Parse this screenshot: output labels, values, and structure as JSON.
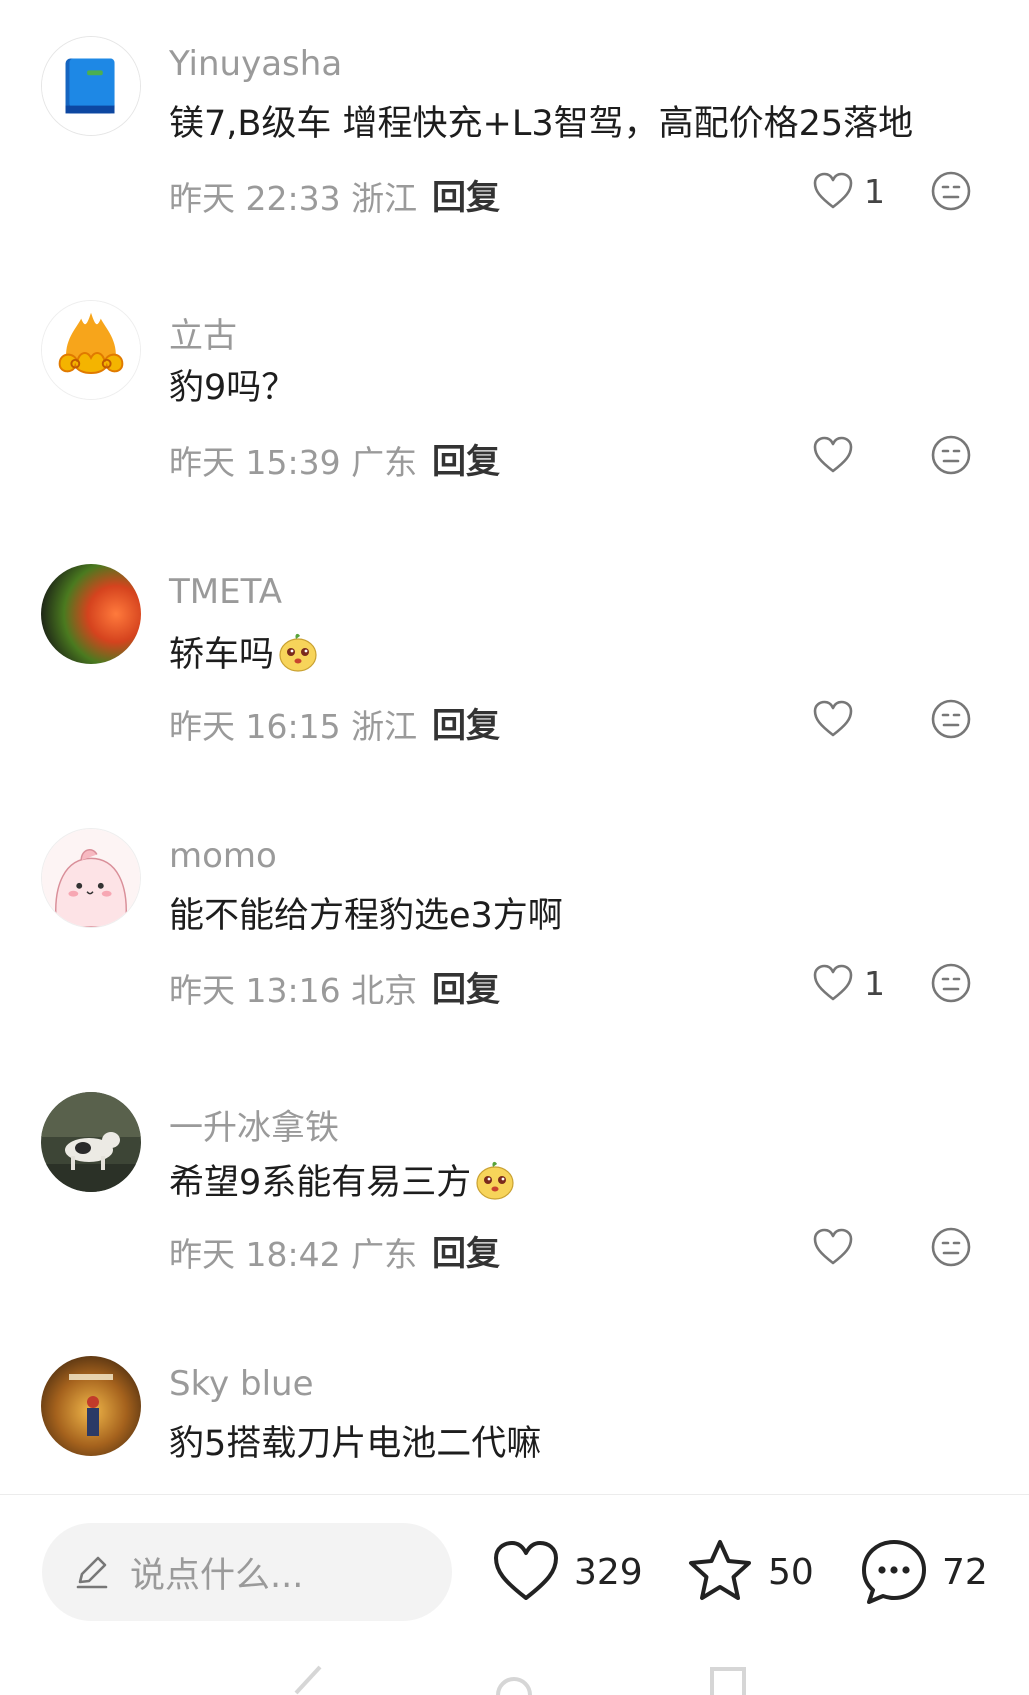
{
  "comments": [
    {
      "username": "Yinuyasha",
      "text": "镁7,B级车 增程快充+L3智驾，高配价格25落地",
      "time": "昨天 22:33 浙江",
      "reply": "回复",
      "likes": "1",
      "avatar": "blue-book-avatar"
    },
    {
      "username": "立古",
      "text": "豹9吗？",
      "time": "昨天 15:39 广东",
      "reply": "回复",
      "likes": "",
      "avatar": "golden-cloud-avatar"
    },
    {
      "username": "TMETA",
      "text": "轿车吗",
      "time": "昨天 16:15 浙江",
      "reply": "回复",
      "likes": "",
      "avatar": "gradient-avatar",
      "emoji": "cute-face-emoji"
    },
    {
      "username": "momo",
      "text": "能不能给方程豹选e3方啊",
      "time": "昨天 13:16 北京",
      "reply": "回复",
      "likes": "1",
      "avatar": "pink-cartoon-avatar"
    },
    {
      "username": "一升冰拿铁",
      "text": "希望9系能有易三方",
      "time": "昨天 18:42 广东",
      "reply": "回复",
      "likes": "",
      "avatar": "dog-photo-avatar",
      "emoji": "cute-face-emoji"
    },
    {
      "username": "Sky blue",
      "text": "豹5搭载刀片电池二代嘛",
      "avatar": "concert-photo-avatar"
    }
  ],
  "bottom_bar": {
    "input_placeholder": "说点什么...",
    "like_count": "329",
    "star_count": "50",
    "comment_count": "72"
  },
  "colors": {
    "muted_text": "#9a9a9a",
    "body_text": "#1d1d1d",
    "icon": "#777777"
  }
}
